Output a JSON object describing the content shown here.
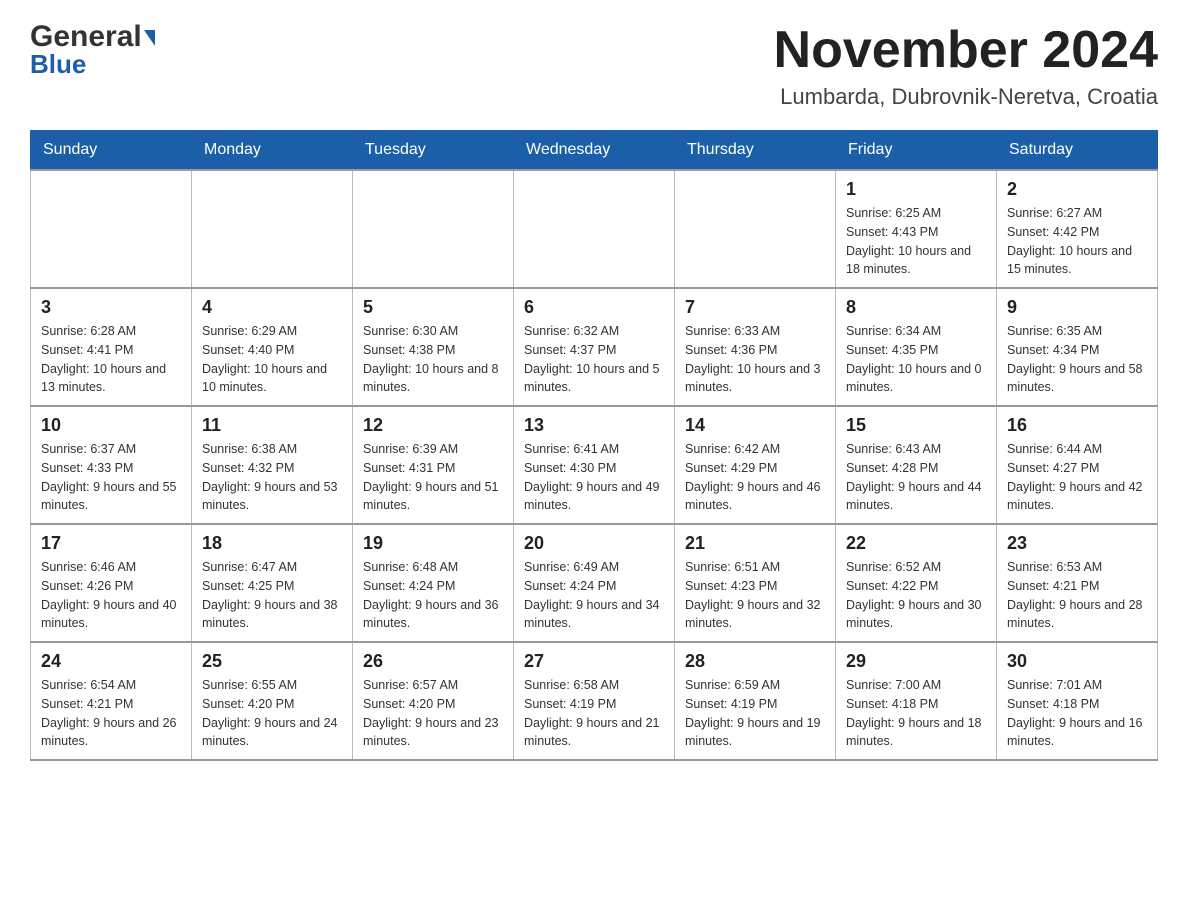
{
  "header": {
    "logo_general": "General",
    "logo_blue": "Blue",
    "title": "November 2024",
    "subtitle": "Lumbarda, Dubrovnik-Neretva, Croatia"
  },
  "days_of_week": [
    "Sunday",
    "Monday",
    "Tuesday",
    "Wednesday",
    "Thursday",
    "Friday",
    "Saturday"
  ],
  "weeks": [
    [
      {
        "day": "",
        "info": ""
      },
      {
        "day": "",
        "info": ""
      },
      {
        "day": "",
        "info": ""
      },
      {
        "day": "",
        "info": ""
      },
      {
        "day": "",
        "info": ""
      },
      {
        "day": "1",
        "info": "Sunrise: 6:25 AM\nSunset: 4:43 PM\nDaylight: 10 hours and 18 minutes."
      },
      {
        "day": "2",
        "info": "Sunrise: 6:27 AM\nSunset: 4:42 PM\nDaylight: 10 hours and 15 minutes."
      }
    ],
    [
      {
        "day": "3",
        "info": "Sunrise: 6:28 AM\nSunset: 4:41 PM\nDaylight: 10 hours and 13 minutes."
      },
      {
        "day": "4",
        "info": "Sunrise: 6:29 AM\nSunset: 4:40 PM\nDaylight: 10 hours and 10 minutes."
      },
      {
        "day": "5",
        "info": "Sunrise: 6:30 AM\nSunset: 4:38 PM\nDaylight: 10 hours and 8 minutes."
      },
      {
        "day": "6",
        "info": "Sunrise: 6:32 AM\nSunset: 4:37 PM\nDaylight: 10 hours and 5 minutes."
      },
      {
        "day": "7",
        "info": "Sunrise: 6:33 AM\nSunset: 4:36 PM\nDaylight: 10 hours and 3 minutes."
      },
      {
        "day": "8",
        "info": "Sunrise: 6:34 AM\nSunset: 4:35 PM\nDaylight: 10 hours and 0 minutes."
      },
      {
        "day": "9",
        "info": "Sunrise: 6:35 AM\nSunset: 4:34 PM\nDaylight: 9 hours and 58 minutes."
      }
    ],
    [
      {
        "day": "10",
        "info": "Sunrise: 6:37 AM\nSunset: 4:33 PM\nDaylight: 9 hours and 55 minutes."
      },
      {
        "day": "11",
        "info": "Sunrise: 6:38 AM\nSunset: 4:32 PM\nDaylight: 9 hours and 53 minutes."
      },
      {
        "day": "12",
        "info": "Sunrise: 6:39 AM\nSunset: 4:31 PM\nDaylight: 9 hours and 51 minutes."
      },
      {
        "day": "13",
        "info": "Sunrise: 6:41 AM\nSunset: 4:30 PM\nDaylight: 9 hours and 49 minutes."
      },
      {
        "day": "14",
        "info": "Sunrise: 6:42 AM\nSunset: 4:29 PM\nDaylight: 9 hours and 46 minutes."
      },
      {
        "day": "15",
        "info": "Sunrise: 6:43 AM\nSunset: 4:28 PM\nDaylight: 9 hours and 44 minutes."
      },
      {
        "day": "16",
        "info": "Sunrise: 6:44 AM\nSunset: 4:27 PM\nDaylight: 9 hours and 42 minutes."
      }
    ],
    [
      {
        "day": "17",
        "info": "Sunrise: 6:46 AM\nSunset: 4:26 PM\nDaylight: 9 hours and 40 minutes."
      },
      {
        "day": "18",
        "info": "Sunrise: 6:47 AM\nSunset: 4:25 PM\nDaylight: 9 hours and 38 minutes."
      },
      {
        "day": "19",
        "info": "Sunrise: 6:48 AM\nSunset: 4:24 PM\nDaylight: 9 hours and 36 minutes."
      },
      {
        "day": "20",
        "info": "Sunrise: 6:49 AM\nSunset: 4:24 PM\nDaylight: 9 hours and 34 minutes."
      },
      {
        "day": "21",
        "info": "Sunrise: 6:51 AM\nSunset: 4:23 PM\nDaylight: 9 hours and 32 minutes."
      },
      {
        "day": "22",
        "info": "Sunrise: 6:52 AM\nSunset: 4:22 PM\nDaylight: 9 hours and 30 minutes."
      },
      {
        "day": "23",
        "info": "Sunrise: 6:53 AM\nSunset: 4:21 PM\nDaylight: 9 hours and 28 minutes."
      }
    ],
    [
      {
        "day": "24",
        "info": "Sunrise: 6:54 AM\nSunset: 4:21 PM\nDaylight: 9 hours and 26 minutes."
      },
      {
        "day": "25",
        "info": "Sunrise: 6:55 AM\nSunset: 4:20 PM\nDaylight: 9 hours and 24 minutes."
      },
      {
        "day": "26",
        "info": "Sunrise: 6:57 AM\nSunset: 4:20 PM\nDaylight: 9 hours and 23 minutes."
      },
      {
        "day": "27",
        "info": "Sunrise: 6:58 AM\nSunset: 4:19 PM\nDaylight: 9 hours and 21 minutes."
      },
      {
        "day": "28",
        "info": "Sunrise: 6:59 AM\nSunset: 4:19 PM\nDaylight: 9 hours and 19 minutes."
      },
      {
        "day": "29",
        "info": "Sunrise: 7:00 AM\nSunset: 4:18 PM\nDaylight: 9 hours and 18 minutes."
      },
      {
        "day": "30",
        "info": "Sunrise: 7:01 AM\nSunset: 4:18 PM\nDaylight: 9 hours and 16 minutes."
      }
    ]
  ]
}
